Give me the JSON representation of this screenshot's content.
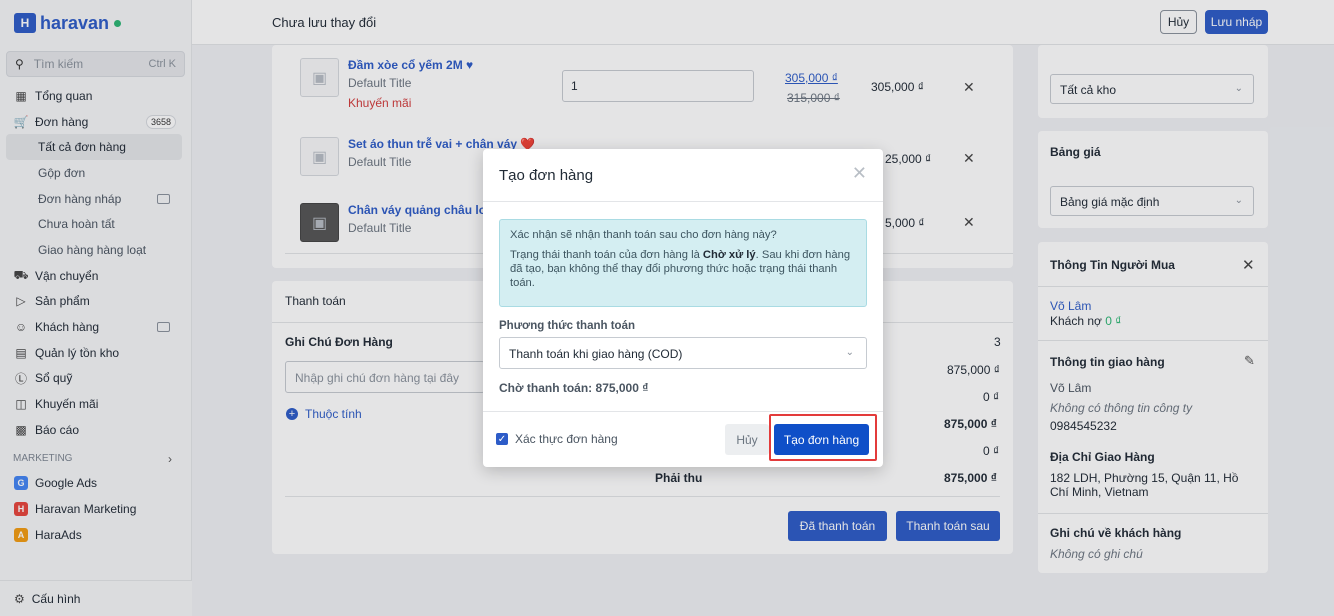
{
  "sidebar": {
    "logo": "haravan",
    "search": {
      "placeholder": "Tìm kiếm",
      "shortcut": "Ctrl K"
    },
    "items": [
      {
        "label": "Tổng quan",
        "icon": "dashboard-icon"
      },
      {
        "label": "Đơn hàng",
        "icon": "cart-icon",
        "badge": "3658"
      },
      {
        "label": "Tất cả đơn hàng"
      },
      {
        "label": "Gộp đơn"
      },
      {
        "label": "Đơn hàng nháp"
      },
      {
        "label": "Chưa hoàn tất"
      },
      {
        "label": "Giao hàng hàng loạt"
      },
      {
        "label": "Vận chuyển",
        "icon": "truck-icon"
      },
      {
        "label": "Sản phẩm",
        "icon": "tag-icon"
      },
      {
        "label": "Khách hàng",
        "icon": "users-icon"
      },
      {
        "label": "Quản lý tồn kho",
        "icon": "inventory-icon"
      },
      {
        "label": "Sổ quỹ",
        "icon": "cash-icon"
      },
      {
        "label": "Khuyến mãi",
        "icon": "gift-icon"
      },
      {
        "label": "Báo cáo",
        "icon": "report-icon"
      }
    ],
    "marketing_label": "MARKETING",
    "apps": [
      {
        "label": "Google Ads",
        "icon": "google-icon",
        "color": "#4285f4",
        "glyph": "G"
      },
      {
        "label": "Haravan Marketing",
        "icon": "haravan-marketing-icon",
        "color": "#e8453c",
        "glyph": "H"
      },
      {
        "label": "HaraAds",
        "icon": "haraads-icon",
        "color": "#f39c12",
        "glyph": "A"
      }
    ],
    "settings": "Cấu hình"
  },
  "topbar": {
    "title": "Chưa lưu thay đổi",
    "cancel": "Hủy",
    "save": "Lưu nháp"
  },
  "products": [
    {
      "name": "Đầm xòe cổ yếm 2M ♥",
      "variant": "Default Title",
      "promo": "Khuyến mãi",
      "qty": "1",
      "price_new": "305,000 ₫",
      "price_old": "315,000 ₫",
      "total": "305,000 ₫"
    },
    {
      "name": "Set áo thun trễ vai + chân váy ❤️",
      "variant": "Default Title",
      "total": "25,000 ₫"
    },
    {
      "name": "Chân váy quảng châu loại",
      "variant": "Default Title",
      "total": "5,000 ₫"
    }
  ],
  "payment": {
    "title": "Thanh toán",
    "note_label": "Ghi Chú Đơn Hàng",
    "note_placeholder": "Nhập ghi chú đơn hàng tại đây",
    "attributes": "Thuộc tính",
    "summary": [
      "3",
      "875,000 ₫",
      "0 ₫",
      "875,000 ₫",
      "0 ₫"
    ],
    "must_collect_label": "Phải thu",
    "must_collect_value": "875,000 ₫",
    "paid_btn": "Đã thanh toán",
    "later_btn": "Thanh toán sau"
  },
  "right": {
    "warehouse": "Tất cả kho",
    "pricelist_title": "Bảng giá",
    "pricelist": "Bảng giá mặc định",
    "buyer_title": "Thông Tin Người Mua",
    "buyer_name": "Võ Lâm",
    "buyer_debt_label": "Khách nợ ",
    "buyer_debt_value": "0 ₫",
    "shipping_title": "Thông tin giao hàng",
    "shipping_name": "Võ Lâm",
    "shipping_company": "Không có thông tin công ty",
    "shipping_phone": "0984545232",
    "address_title": "Địa Chỉ Giao Hàng",
    "address": "182 LDH, Phường 15, Quận 11, Hồ Chí Minh, Vietnam",
    "customer_note_title": "Ghi chú về khách hàng",
    "customer_note": "Không có ghi chú"
  },
  "modal": {
    "title": "Tạo đơn hàng",
    "alert_q": "Xác nhận sẽ nhận thanh toán sau cho đơn hàng này?",
    "alert_1": "Trạng thái thanh toán của đơn hàng là ",
    "alert_bold": "Chờ xử lý",
    "alert_2": ". Sau khi đơn hàng đã tạo, bạn không thể thay đổi phương thức hoặc trạng thái thanh toán.",
    "pm_label": "Phương thức thanh toán",
    "pm_value": "Thanh toán khi giao hàng (COD)",
    "waiting": "Chờ thanh toán: 875,000 ₫",
    "confirm_label": "Xác thực đơn hàng",
    "cancel": "Hủy",
    "create": "Tạo đơn hàng"
  },
  "colors": {
    "brand": "#2d5cc8",
    "highlight": "#e33b3b"
  }
}
